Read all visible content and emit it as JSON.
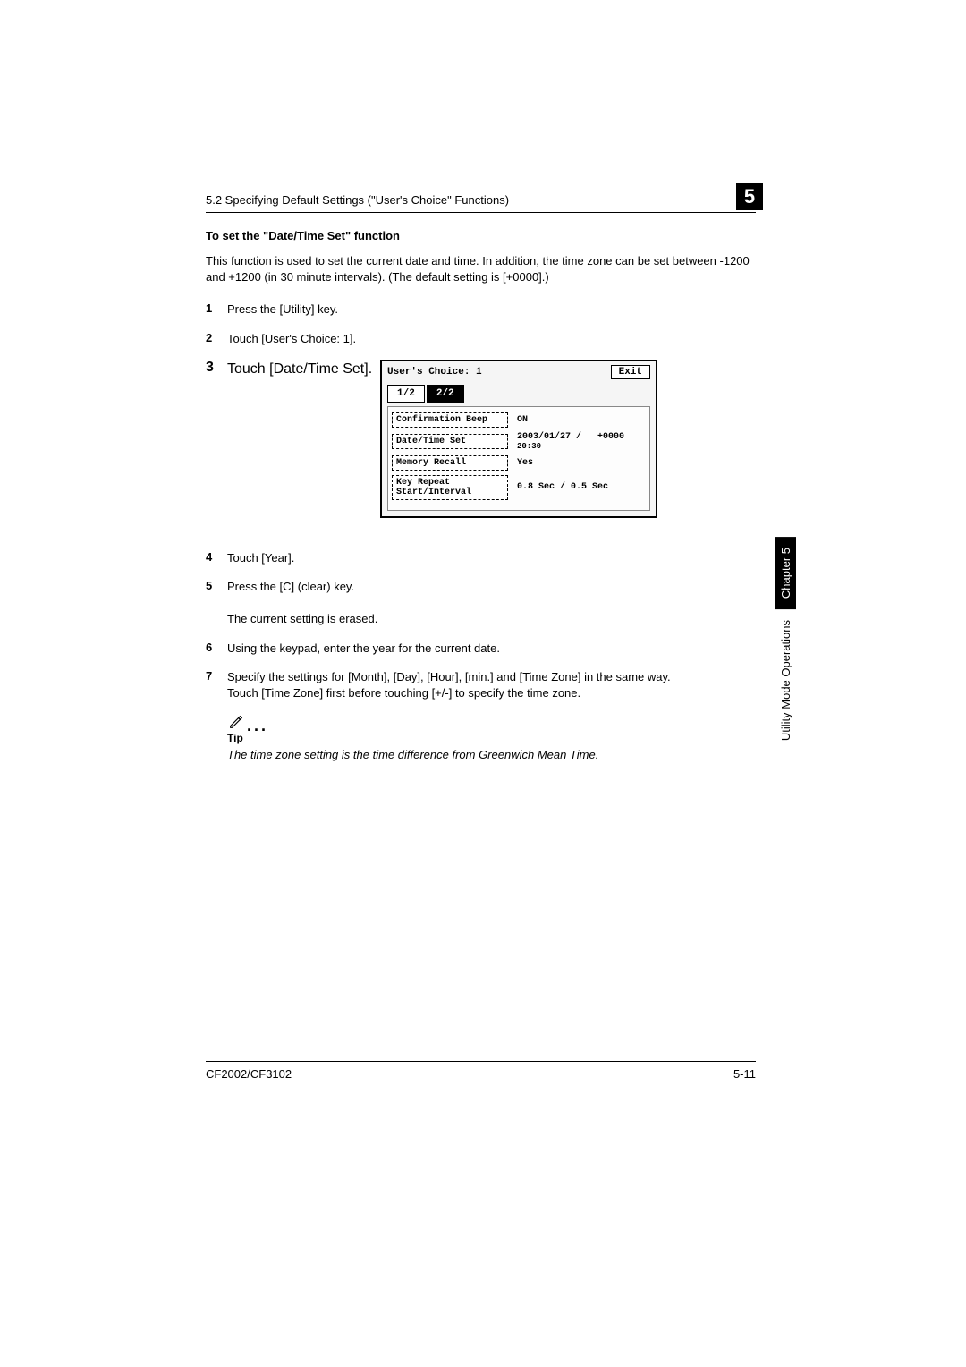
{
  "header": {
    "breadcrumb": "5.2 Specifying Default Settings (\"User's Choice\" Functions)",
    "chapter_num": "5"
  },
  "section_title": "To set the \"Date/Time Set\" function",
  "intro": "This function is used to set the current date and time. In addition, the time zone can be set between -1200 and +1200 (in 30 minute intervals). (The default setting is [+0000].)",
  "steps": {
    "s1": "Press the [Utility] key.",
    "s2": "Touch [User's Choice: 1].",
    "s3": "Touch [Date/Time Set].",
    "s4": "Touch [Year].",
    "s5": "Press the [C] (clear) key.",
    "s5b": "The current setting is erased.",
    "s6": "Using the keypad, enter the year for the current date.",
    "s7a": "Specify the settings for [Month], [Day], [Hour], [min.] and [Time Zone] in the same way.",
    "s7b": "Touch [Time Zone] first before touching [+/-] to specify the time zone."
  },
  "lcd": {
    "title": "User's Choice: 1",
    "exit": "Exit",
    "tab1": "1/2",
    "tab2": "2/2",
    "rows": {
      "r1_label": "Confirmation Beep",
      "r1_val": "ON",
      "r2_label": "Date/Time Set",
      "r2_val1": "2003/01/27 /",
      "r2_val2": "20:30",
      "r2_val3": "+0000",
      "r3_label": "Memory Recall",
      "r3_val": "Yes",
      "r4_label1": "Key Repeat",
      "r4_label2": "Start/Interval",
      "r4_val": "0.8 Sec /   0.5 Sec"
    }
  },
  "tip": {
    "label": "Tip",
    "text": "The time zone setting is the time difference from Greenwich Mean Time."
  },
  "footer": {
    "left": "CF2002/CF3102",
    "right": "5-11"
  },
  "side": {
    "chapter": "Chapter 5",
    "label": "Utility Mode Operations"
  }
}
